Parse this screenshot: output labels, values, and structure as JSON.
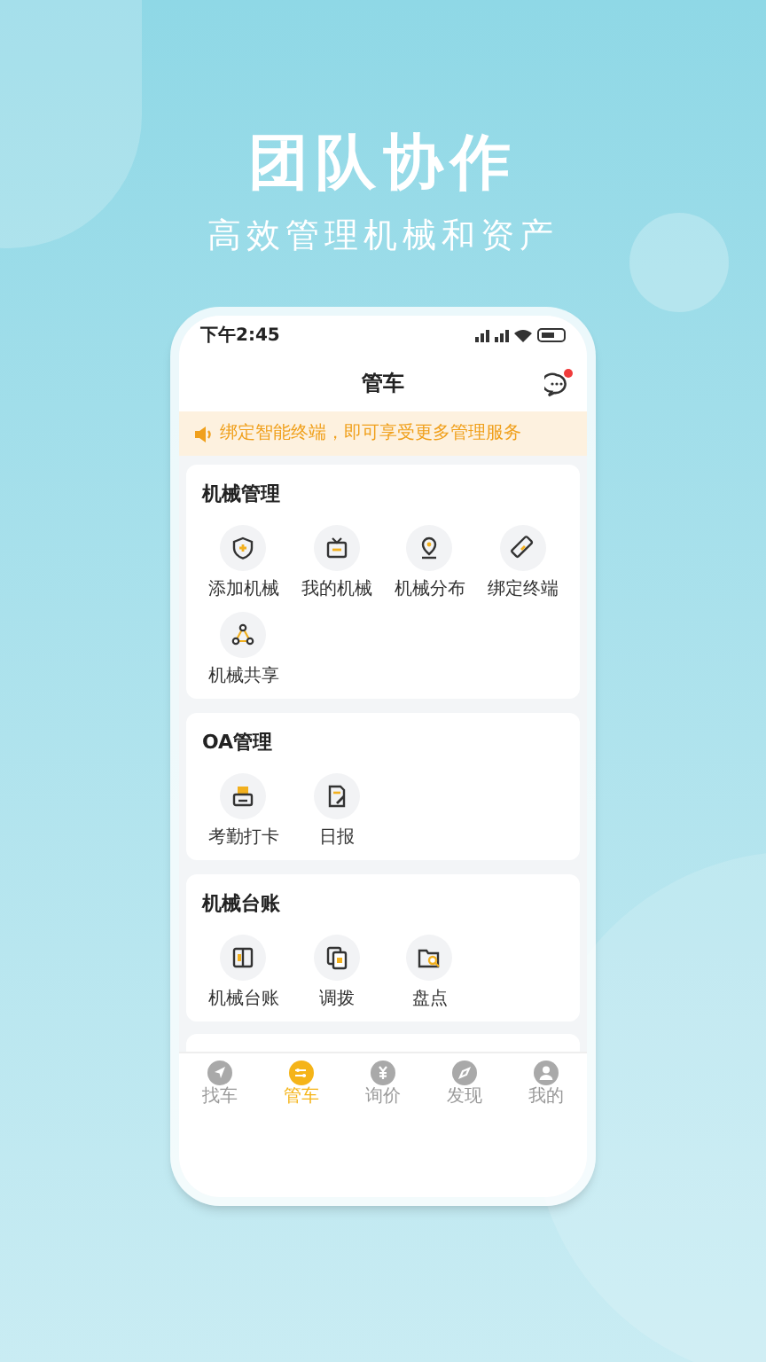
{
  "headline": "团队协作",
  "subtitle": "高效管理机械和资产",
  "status_bar": {
    "time": "下午2:45"
  },
  "nav": {
    "title": "管车",
    "message_badge": true
  },
  "notice": {
    "text": "绑定智能终端，即可享受更多管理服务"
  },
  "sections": [
    {
      "title": "机械管理",
      "items": [
        {
          "label": "添加机械"
        },
        {
          "label": "我的机械"
        },
        {
          "label": "机械分布"
        },
        {
          "label": "绑定终端"
        },
        {
          "label": "机械共享"
        }
      ]
    },
    {
      "title": "OA管理",
      "items": [
        {
          "label": "考勤打卡"
        },
        {
          "label": "日报"
        }
      ]
    },
    {
      "title": "机械台账",
      "items": [
        {
          "label": "机械台账"
        },
        {
          "label": "调拨"
        },
        {
          "label": "盘点"
        }
      ]
    }
  ],
  "tabbar": [
    {
      "label": "找车",
      "selected": false
    },
    {
      "label": "管车",
      "selected": true
    },
    {
      "label": "询价",
      "selected": false
    },
    {
      "label": "发现",
      "selected": false
    },
    {
      "label": "我的",
      "selected": false
    }
  ]
}
